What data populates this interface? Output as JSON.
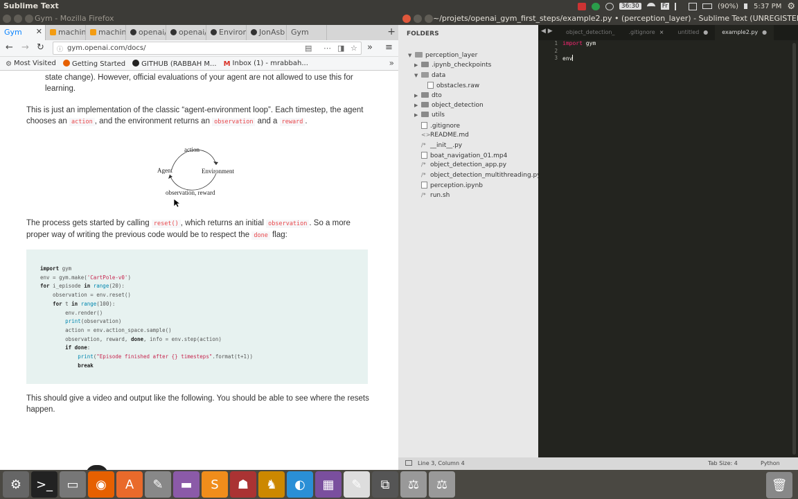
{
  "top_panel": {
    "app_name": "Sublime Text",
    "timer": "36:30",
    "keyboard": "Fr",
    "battery": "(90%)",
    "clock": "5:37 PM"
  },
  "firefox": {
    "window_title": "Gym - Mozilla Firefox",
    "tabs": [
      {
        "label": "Gym",
        "active": true
      },
      {
        "label": "machine"
      },
      {
        "label": "machine"
      },
      {
        "label": "openai/"
      },
      {
        "label": "openai/"
      },
      {
        "label": "Environ"
      },
      {
        "label": "JonAsb"
      },
      {
        "label": "Gym"
      }
    ],
    "url": "gym.openai.com/docs/",
    "bookmarks": [
      "Most Visited",
      "Getting Started",
      "GITHUB (RABBAH M...",
      "Inbox (1) - mrabbah..."
    ],
    "content": {
      "p0": "state change). However, official evaluations of your agent are not allowed to use this for learning.",
      "p1_a": "This is just an implementation of the classic “agent-environment loop”. Each timestep, the agent chooses an",
      "p1_code1": "action",
      "p1_b": ", and the environment returns an",
      "p1_code2": "observation",
      "p1_c": "and a",
      "p1_code3": "reward",
      "p1_d": ".",
      "diagram": {
        "action": "action",
        "agent": "Agent",
        "environment": "Environment",
        "observation": "observation, reward"
      },
      "p2_a": "The process gets started by calling",
      "p2_code1": "reset()",
      "p2_b": ", which returns an initial",
      "p2_code2": "observation",
      "p2_c": ". So a more proper way of writing the previous code would be to respect the",
      "p2_code3": "done",
      "p2_d": "flag:",
      "code_lines": [
        "import gym",
        "env = gym.make('CartPole-v0')",
        "for i_episode in range(20):",
        "    observation = env.reset()",
        "    for t in range(100):",
        "        env.render()",
        "        print(observation)",
        "        action = env.action_space.sample()",
        "        observation, reward, done, info = env.step(action)",
        "        if done:",
        "            print(\"Episode finished after {} timesteps\".format(t+1))",
        "            break"
      ],
      "p3": "This should give a video and output like the following. You should be able to see where the resets happen."
    }
  },
  "sublime": {
    "window_title": "~/projets/openai_gym_first_steps/example2.py • (perception_layer) - Sublime Text (UNREGISTERED)",
    "folders_header": "FOLDERS",
    "tree": [
      {
        "label": "perception_layer",
        "type": "folder-open",
        "depth": 0
      },
      {
        "label": ".ipynb_checkpoints",
        "type": "folder",
        "depth": 1
      },
      {
        "label": "data",
        "type": "folder-open",
        "depth": 1
      },
      {
        "label": "obstacles.raw",
        "type": "file",
        "depth": 2
      },
      {
        "label": "dto",
        "type": "folder",
        "depth": 1
      },
      {
        "label": "object_detection",
        "type": "folder",
        "depth": 1
      },
      {
        "label": "utils",
        "type": "folder",
        "depth": 1
      },
      {
        "label": ".gitignore",
        "type": "file",
        "depth": 1
      },
      {
        "label": "README.md",
        "type": "md",
        "depth": 1
      },
      {
        "label": "__init__.py",
        "type": "py",
        "depth": 1
      },
      {
        "label": "boat_navigation_01.mp4",
        "type": "file",
        "depth": 1
      },
      {
        "label": "object_detection_app.py",
        "type": "py",
        "depth": 1
      },
      {
        "label": "object_detection_multithreading.py",
        "type": "py",
        "depth": 1
      },
      {
        "label": "perception.ipynb",
        "type": "file",
        "depth": 1
      },
      {
        "label": "run.sh",
        "type": "py",
        "depth": 1
      }
    ],
    "tabs": [
      {
        "label": "object_detection_",
        "close": ""
      },
      {
        "label": ".gitignore",
        "close": "×"
      },
      {
        "label": "untitled",
        "close": "●"
      },
      {
        "label": "example2.py",
        "close": "●",
        "active": true
      }
    ],
    "gutter": [
      "1",
      "2",
      "3"
    ],
    "code": {
      "l1_kw": "import",
      "l1_rest": " gym",
      "l3": "env"
    },
    "status": {
      "position": "Line 3, Column 4",
      "tab_size": "Tab Size: 4",
      "syntax": "Python"
    }
  },
  "dock": [
    "system-settings",
    "terminal",
    "files",
    "firefox",
    "software-center",
    "tools",
    "presentation",
    "sublime",
    "game",
    "game2",
    "browser-alt",
    "monitor",
    "text-editor",
    "window1",
    "scale1",
    "scale2",
    "trash"
  ]
}
